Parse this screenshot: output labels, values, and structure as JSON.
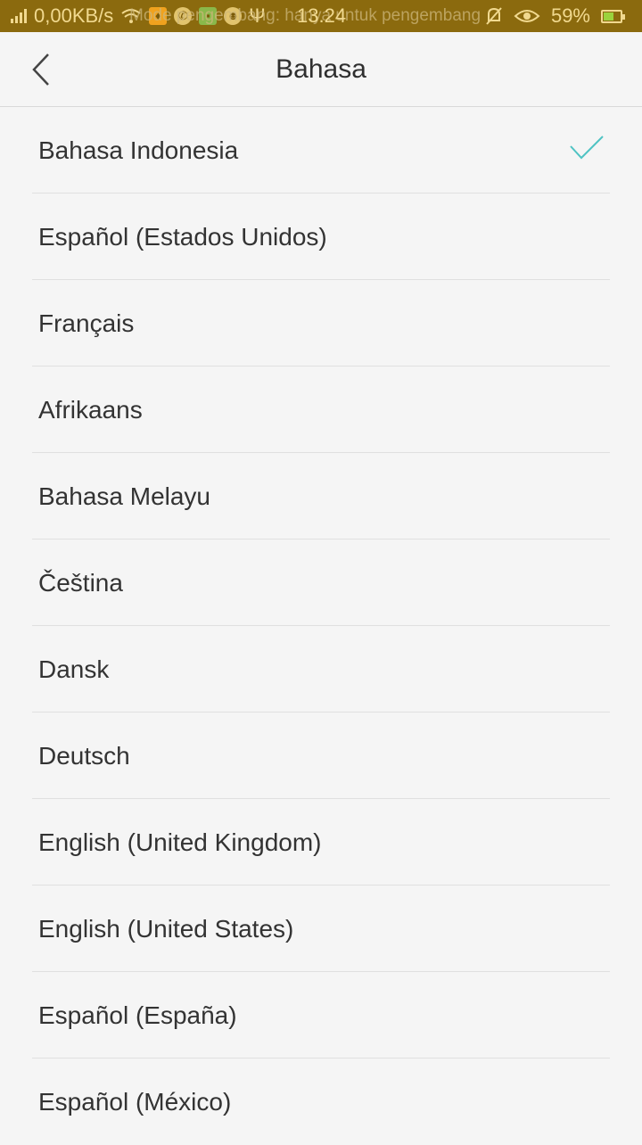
{
  "status_bar": {
    "speed": "0,00KB/s",
    "time": "13.24",
    "battery": "59%",
    "battery_level": 0.59,
    "overlay_text": "Mode pengembang: hanya untuk pengembang",
    "icons": [
      "signal-icon",
      "wifi-icon",
      "notification-icon",
      "whatsapp-icon",
      "app-icon",
      "android-icon",
      "usb-icon",
      "mute-icon",
      "eye-icon",
      "battery-icon"
    ]
  },
  "header": {
    "title": "Bahasa",
    "back_icon": "chevron-left-icon"
  },
  "languages": {
    "selected_index": 0,
    "check_icon": "checkmark-icon",
    "check_color": "#4fc3c3",
    "items": [
      "Bahasa Indonesia",
      "Español (Estados Unidos)",
      "Français",
      "Afrikaans",
      "Bahasa Melayu",
      "Čeština",
      "Dansk",
      "Deutsch",
      "English (United Kingdom)",
      "English (United States)",
      "Español (España)",
      "Español (México)"
    ]
  },
  "colors": {
    "status_bar_bg": "#8b6a0e",
    "background": "#f5f5f5",
    "divider": "#e0e0e0",
    "text": "#333333"
  }
}
